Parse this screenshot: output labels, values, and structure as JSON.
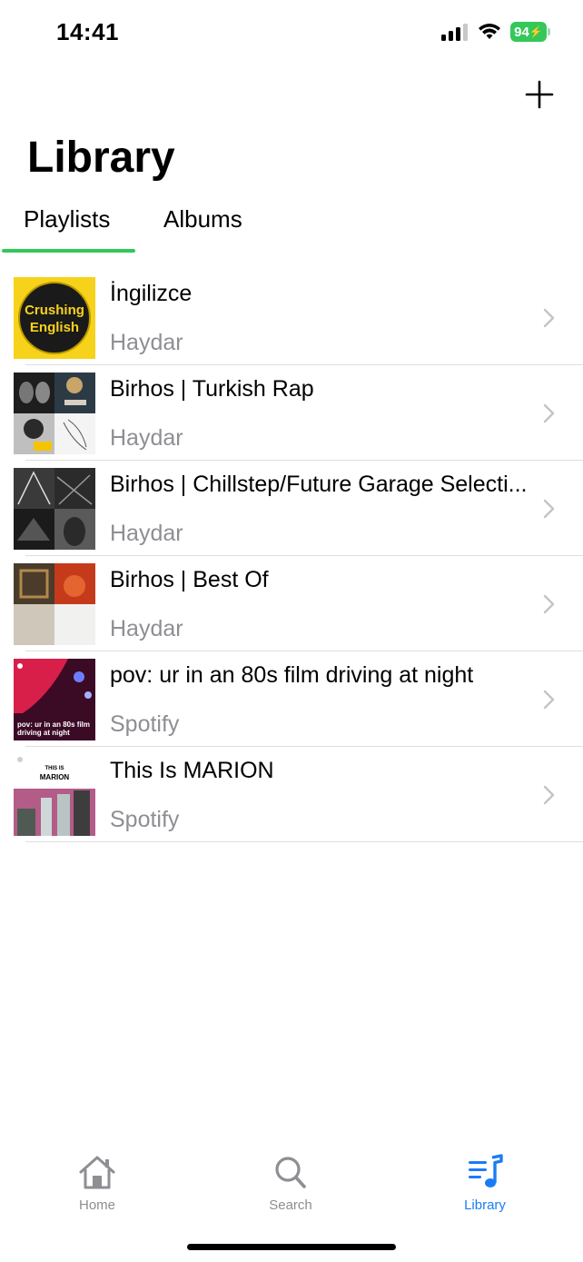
{
  "status_bar": {
    "time": "14:41",
    "battery": "94",
    "icons": [
      "cellular-signal-icon",
      "wifi-icon",
      "battery-charging-icon"
    ]
  },
  "header": {
    "title": "Library",
    "add_icon": "plus-icon"
  },
  "tabs": [
    {
      "label": "Playlists",
      "selected": true
    },
    {
      "label": "Albums",
      "selected": false
    }
  ],
  "colors": {
    "accent_green": "#34c759",
    "active_blue": "#1a7cf5",
    "secondary_text": "#8e8e93"
  },
  "playlists": [
    {
      "title": "İngilizce",
      "owner": "Haydar",
      "cover_text": [
        "Crushing",
        "English"
      ]
    },
    {
      "title": "Birhos | Turkish Rap",
      "owner": "Haydar"
    },
    {
      "title": "Birhos | Chillstep/Future Garage Selecti...",
      "owner": "Haydar"
    },
    {
      "title": "Birhos | Best Of",
      "owner": "Haydar"
    },
    {
      "title": "pov: ur in an 80s film driving at night",
      "owner": "Spotify",
      "cover_text": [
        "pov: ur in an 80s film",
        "driving at night"
      ]
    },
    {
      "title": "This Is MARION",
      "owner": "Spotify",
      "cover_text": [
        "THIS IS",
        "MARION"
      ]
    }
  ],
  "tab_bar": {
    "items": [
      {
        "label": "Home",
        "icon": "home-icon",
        "active": false
      },
      {
        "label": "Search",
        "icon": "search-icon",
        "active": false
      },
      {
        "label": "Library",
        "icon": "music-library-icon",
        "active": true
      }
    ]
  }
}
